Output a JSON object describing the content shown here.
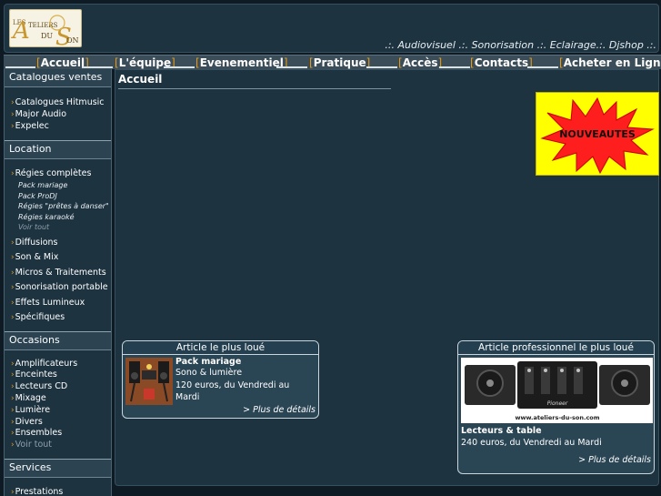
{
  "header": {
    "logo_text_top": "LES ATELIERS",
    "logo_text_bottom": "DU SON",
    "tagline": ".:. Audiovisuel .:. Sonorisation .:. Eclairage.:. Djshop .:."
  },
  "nav": {
    "items": [
      {
        "label": "Accueil",
        "active": true
      },
      {
        "label": "L'équipe"
      },
      {
        "label": "Evenementiel"
      },
      {
        "label": "Pratique"
      },
      {
        "label": "Accès"
      },
      {
        "label": "Contacts"
      },
      {
        "label": "Acheter en Ligne"
      }
    ]
  },
  "sidebar": {
    "catalogues": {
      "title": "Catalogues ventes",
      "items": [
        "Catalogues Hitmusic",
        "Major Audio",
        "Expelec"
      ]
    },
    "location": {
      "title": "Location",
      "regies": "Régies complètes",
      "regies_sub": [
        "Pack mariage",
        "Pack ProDJ",
        "Régies \"prêtes à danser\"",
        "Régies karaoké",
        "Voir tout"
      ],
      "items": [
        "Diffusions",
        "Son & Mix",
        "Micros & Traitements",
        "Sonorisation portable",
        "Effets Lumineux",
        "Spécifiques"
      ]
    },
    "occasions": {
      "title": "Occasions",
      "items": [
        "Amplificateurs",
        "Enceintes",
        "Lecteurs CD",
        "Mixage",
        "Lumière",
        "Divers",
        "Ensembles",
        "Voir tout"
      ]
    },
    "services": {
      "title": "Services",
      "items": [
        "Prestations"
      ]
    }
  },
  "main": {
    "title": "Accueil",
    "promo": "NOUVEAUTES",
    "card1": {
      "header": "Article le plus loué",
      "title": "Pack mariage",
      "subtitle": "Sono & lumière",
      "price": "120 euros, du Vendredi au Mardi",
      "more": "> Plus de détails"
    },
    "card2": {
      "header": "Article professionnel le plus loué",
      "image_caption": "www.ateliers-du-son.com",
      "brand": "Pioneer",
      "title": "Lecteurs & table",
      "price": "240 euros, du Vendredi au Mardi",
      "more": "> Plus de détails"
    }
  },
  "colors": {
    "background": "#0f1b24",
    "panel": "#1e3340",
    "accent": "#e59a1a",
    "promo_bg": "#ffff00",
    "promo_star": "#ff1e1e"
  }
}
